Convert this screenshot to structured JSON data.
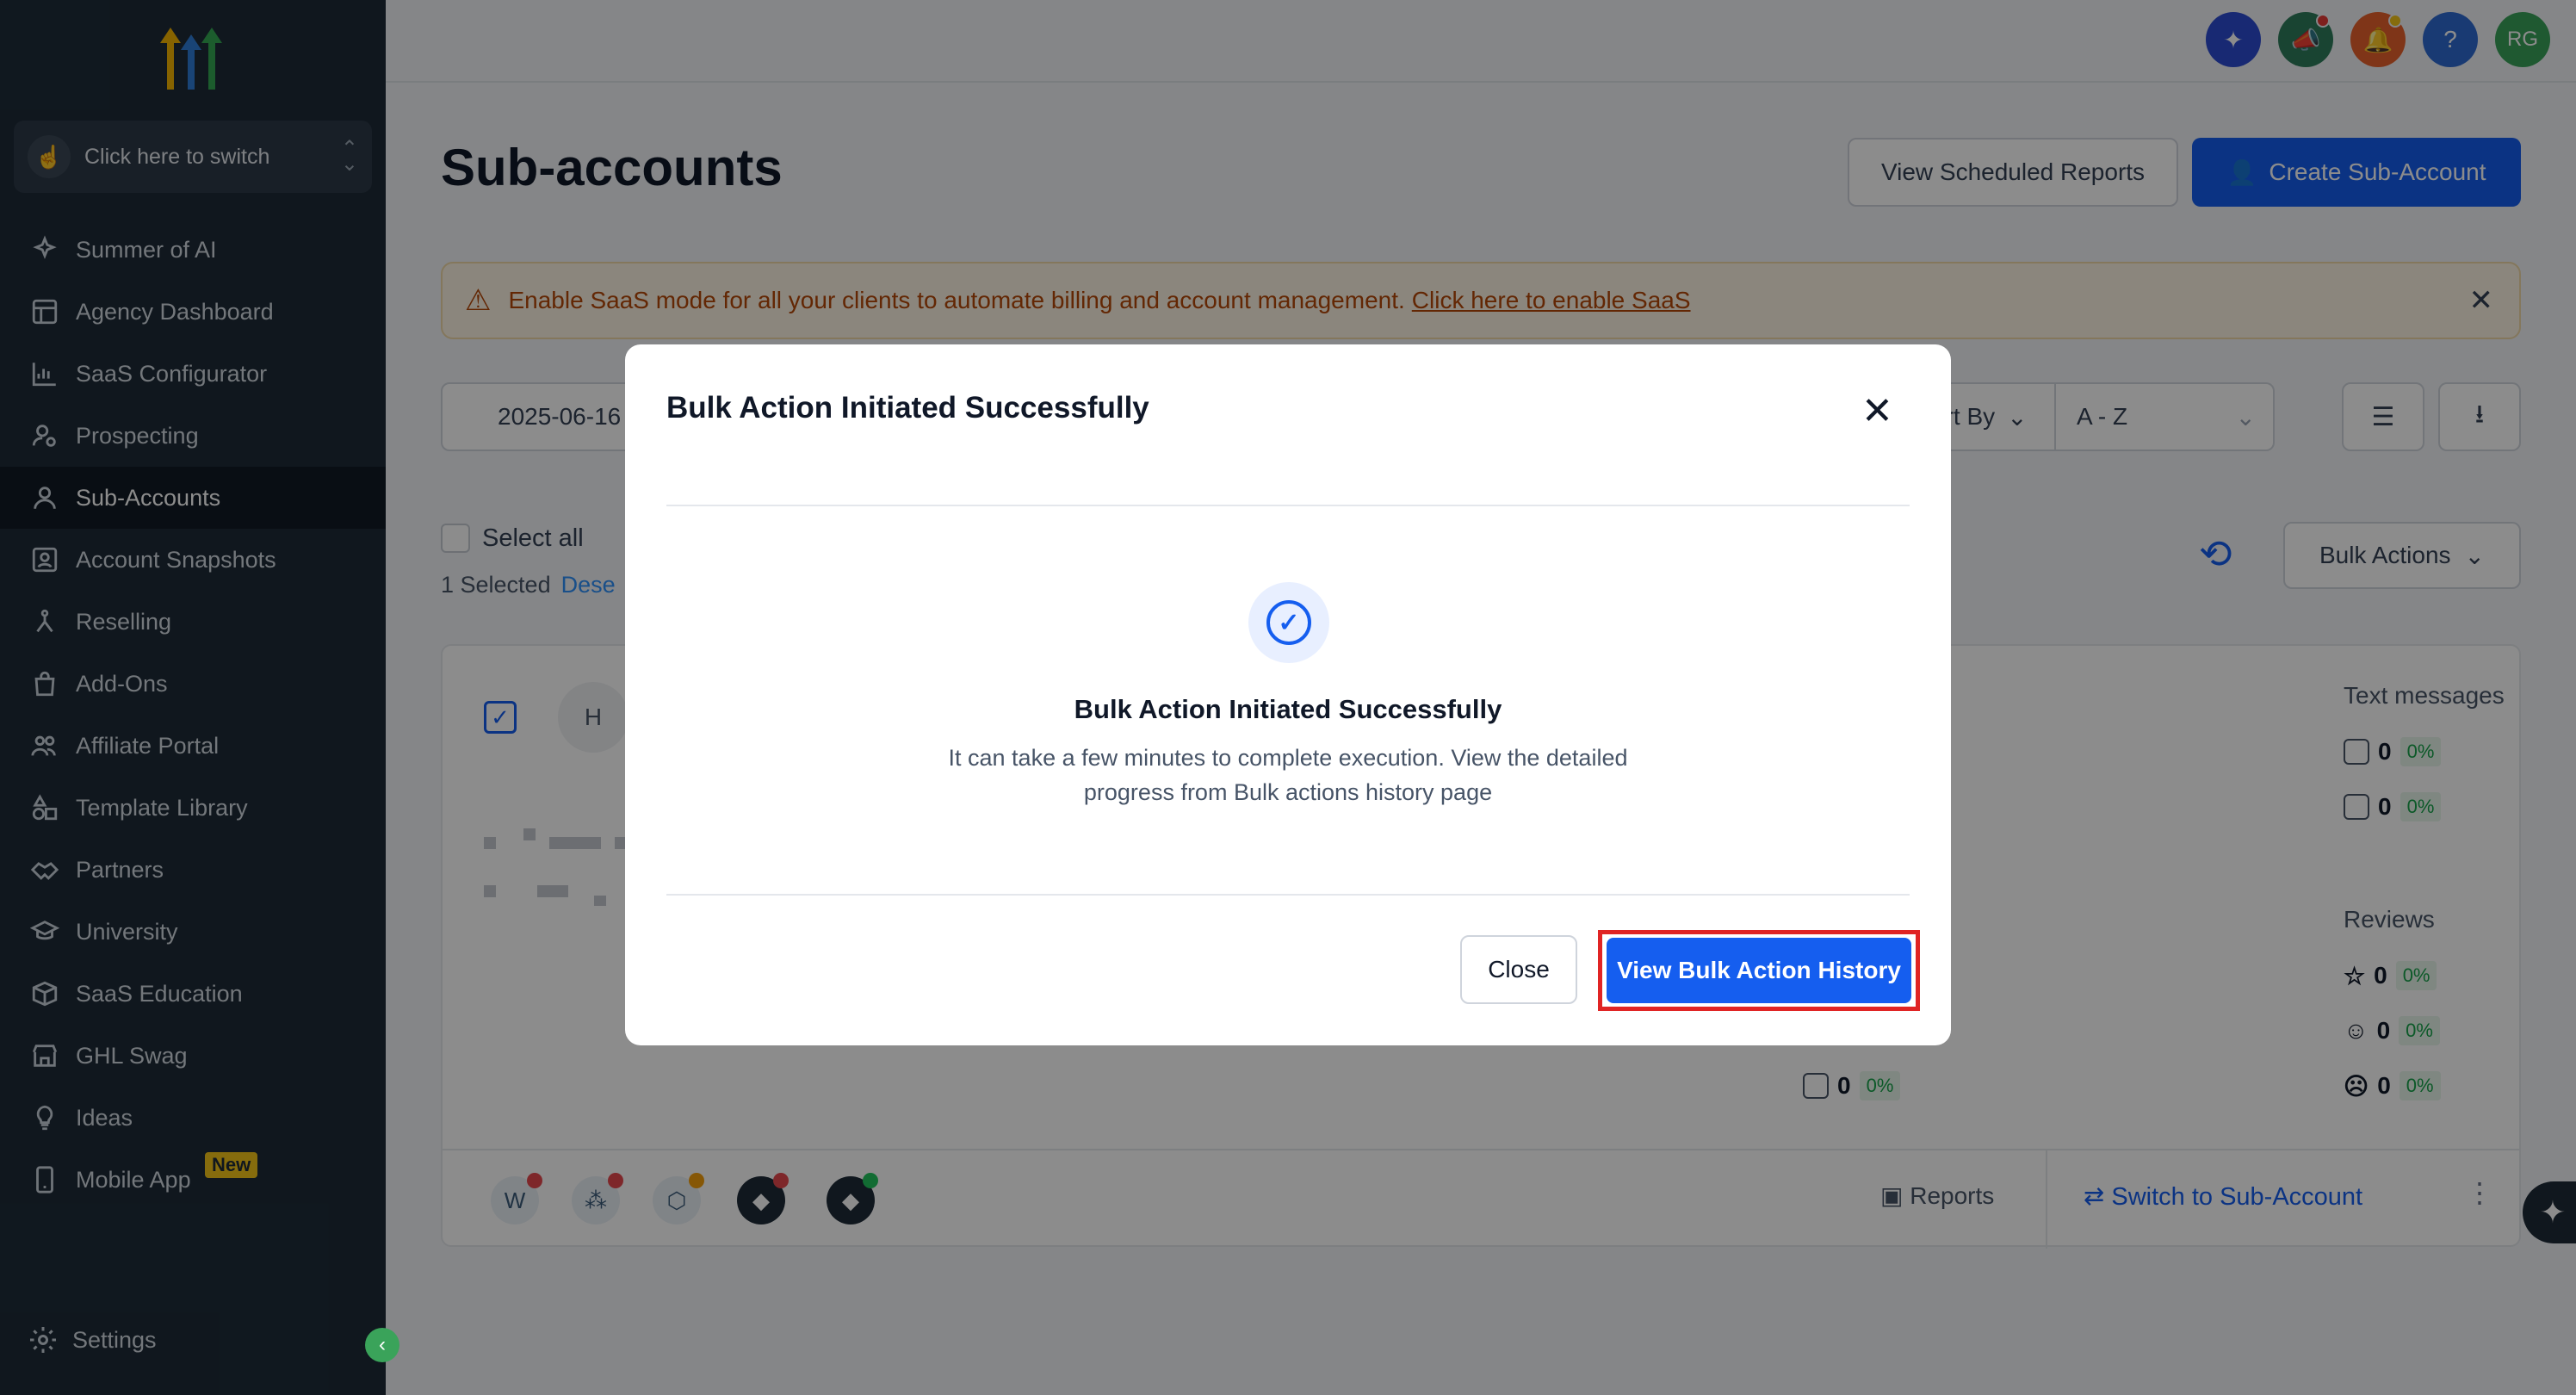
{
  "sidebar": {
    "switcher_label": "Click here to switch",
    "items": [
      {
        "label": "Summer of AI",
        "icon": "sparkle-icon"
      },
      {
        "label": "Agency Dashboard",
        "icon": "dashboard-icon"
      },
      {
        "label": "SaaS Configurator",
        "icon": "bar-chart-icon"
      },
      {
        "label": "Prospecting",
        "icon": "user-search-icon"
      },
      {
        "label": "Sub-Accounts",
        "icon": "user-icon",
        "active": true
      },
      {
        "label": "Account Snapshots",
        "icon": "snapshot-icon"
      },
      {
        "label": "Reselling",
        "icon": "reselling-icon"
      },
      {
        "label": "Add-Ons",
        "icon": "bag-icon"
      },
      {
        "label": "Affiliate Portal",
        "icon": "users-icon"
      },
      {
        "label": "Template Library",
        "icon": "shapes-icon"
      },
      {
        "label": "Partners",
        "icon": "handshake-icon"
      },
      {
        "label": "University",
        "icon": "graduation-cap-icon"
      },
      {
        "label": "SaaS Education",
        "icon": "box-icon"
      },
      {
        "label": "GHL Swag",
        "icon": "store-icon"
      },
      {
        "label": "Ideas",
        "icon": "lightbulb-icon"
      },
      {
        "label": "Mobile App",
        "icon": "phone-icon",
        "badge": "New"
      }
    ],
    "settings_label": "Settings"
  },
  "topbar": {
    "avatar_initials": "RG",
    "help_label": "?"
  },
  "page": {
    "title": "Sub-accounts",
    "view_scheduled_reports": "View Scheduled Reports",
    "create_sub_account": "Create Sub-Account"
  },
  "banner": {
    "text": "Enable SaaS mode for all your clients to automate billing and account management.",
    "link": "Click here to enable SaaS"
  },
  "filters": {
    "date": "2025-06-16",
    "sort_by": "Sort By",
    "sort_value": "A - Z"
  },
  "selection": {
    "select_all": "Select all",
    "selected": "1 Selected",
    "deselect": "Dese"
  },
  "bulk_actions": "Bulk Actions",
  "card": {
    "avatar_initial": "H",
    "text_messages_title": "Text messages",
    "reviews_title": "Reviews",
    "stats": [
      {
        "value": "0",
        "pct": "0%"
      },
      {
        "value": "0",
        "pct": "0%"
      },
      {
        "value": "0",
        "pct": "0%"
      },
      {
        "value": "0",
        "pct": "0%"
      },
      {
        "value": "0",
        "pct": "0%"
      },
      {
        "value": "0",
        "pct": "0%"
      }
    ],
    "reports": "Reports",
    "switch": "Switch to Sub-Account"
  },
  "modal": {
    "title": "Bulk Action Initiated Successfully",
    "heading": "Bulk Action Initiated Successfully",
    "description": "It can take a few minutes to complete execution. View the detailed progress from Bulk actions history page",
    "close": "Close",
    "view_history": "View Bulk Action History"
  },
  "colors": {
    "primary": "#155eef",
    "sidebar": "#1e2b38",
    "highlight": "#e02424"
  }
}
